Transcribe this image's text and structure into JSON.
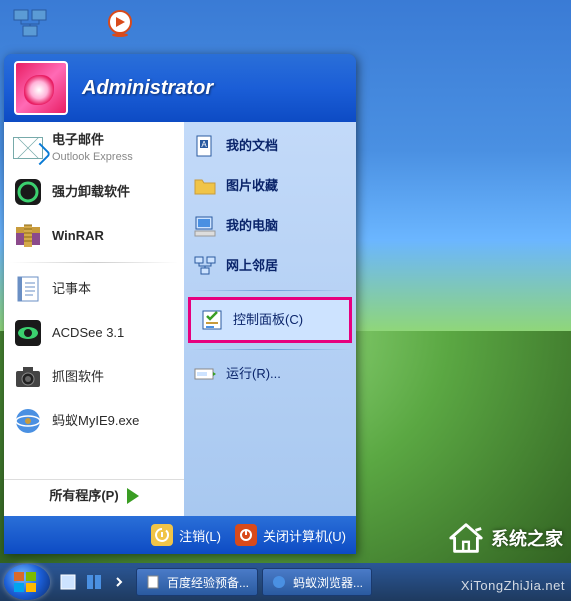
{
  "user": {
    "name": "Administrator"
  },
  "left_panel": {
    "email": {
      "label": "电子邮件",
      "sublabel": "Outlook Express"
    },
    "items": [
      {
        "label": "强力卸载软件"
      },
      {
        "label": "WinRAR"
      }
    ],
    "recent": [
      {
        "label": "记事本"
      },
      {
        "label": "ACDSee 3.1"
      },
      {
        "label": "抓图软件"
      },
      {
        "label": "蚂蚁MyIE9.exe"
      }
    ],
    "all_programs": "所有程序(P)"
  },
  "right_panel": {
    "items_top": [
      {
        "label": "我的文档"
      },
      {
        "label": "图片收藏"
      },
      {
        "label": "我的电脑"
      },
      {
        "label": "网上邻居"
      }
    ],
    "control_panel": {
      "label": "控制面板(C)"
    },
    "run": {
      "label": "运行(R)..."
    }
  },
  "footer": {
    "logoff": "注销(L)",
    "shutdown": "关闭计算机(U)"
  },
  "taskbar": {
    "tasks": [
      {
        "label": "百度经验预备..."
      },
      {
        "label": "蚂蚁浏览器..."
      }
    ]
  },
  "watermark": {
    "text": "系统之家",
    "url": "XiTongZhiJia.net"
  }
}
